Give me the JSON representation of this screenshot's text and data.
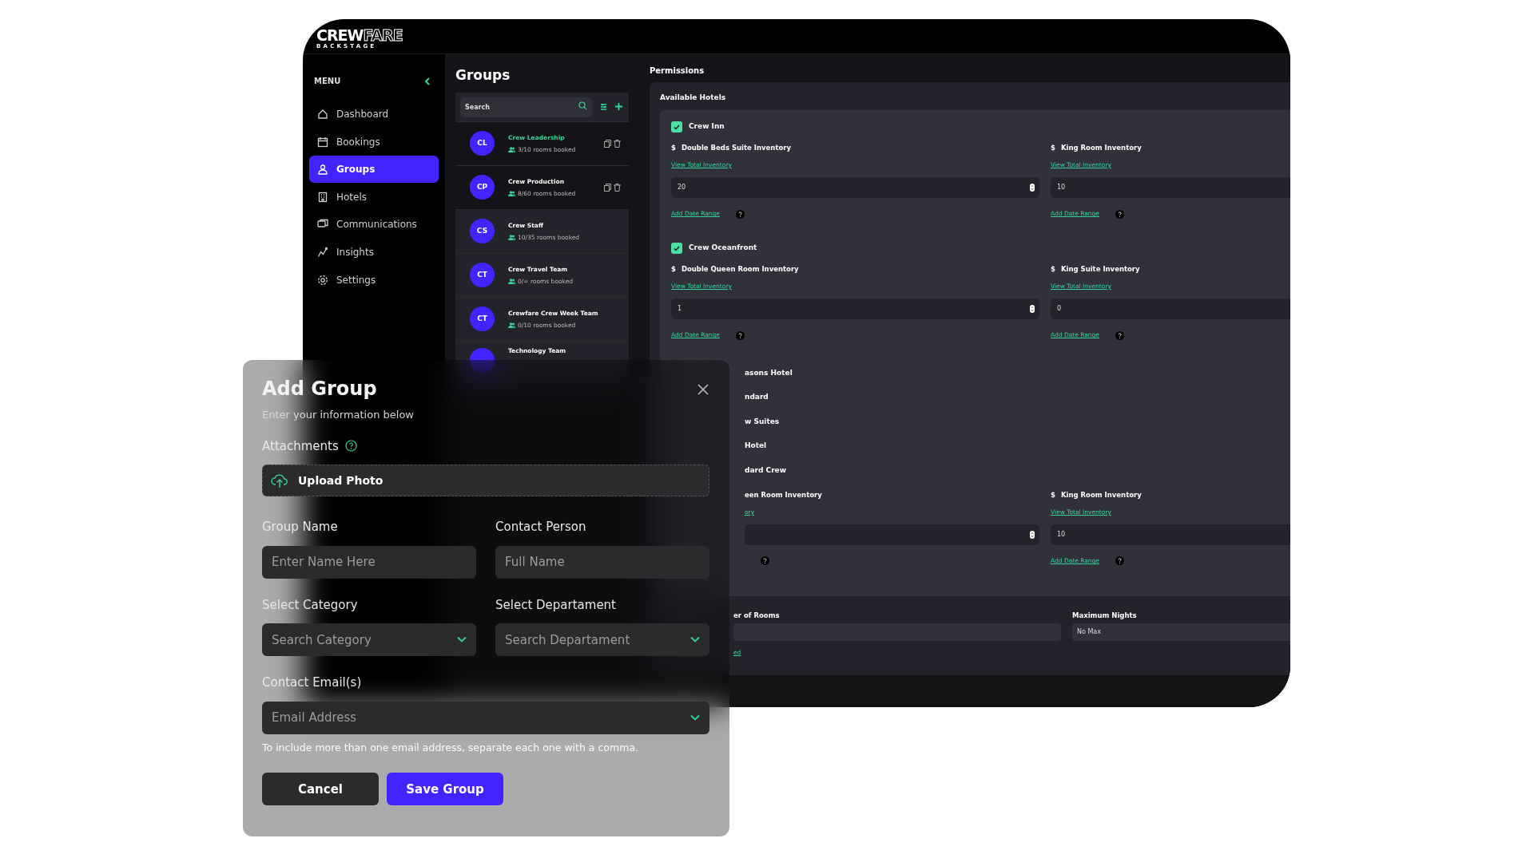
{
  "logo": {
    "main": "CREW",
    "accent": "FARE",
    "sub": "BACKSTAGE"
  },
  "sidebar": {
    "heading": "MENU",
    "items": [
      {
        "label": "Dashboard",
        "selected": false
      },
      {
        "label": "Bookings",
        "selected": false
      },
      {
        "label": "Groups",
        "selected": true
      },
      {
        "label": "Hotels",
        "selected": false
      },
      {
        "label": "Communications",
        "selected": false
      },
      {
        "label": "Insights",
        "selected": false
      },
      {
        "label": "Settings",
        "selected": false
      }
    ]
  },
  "groups": {
    "title": "Groups",
    "search_placeholder": "Search",
    "items": [
      {
        "initials": "CL",
        "name": "Crew Leadership",
        "rooms": "3/10 rooms booked",
        "selected": true,
        "actions": true
      },
      {
        "initials": "CP",
        "name": "Crew Production",
        "rooms": "8/60 rooms booked",
        "selected": false,
        "actions": true
      },
      {
        "initials": "CS",
        "name": "Crew Staff",
        "rooms": "10/35 rooms booked",
        "selected": false,
        "actions": false
      },
      {
        "initials": "CT",
        "name": "Crew Travel Team",
        "rooms": "0/∞ rooms booked",
        "selected": false,
        "actions": false
      },
      {
        "initials": "CT",
        "name": "Crewfare Crew Week Team",
        "rooms": "0/10 rooms booked",
        "selected": false,
        "actions": false
      },
      {
        "name": "Technology Team",
        "selected": false,
        "actions": false
      }
    ]
  },
  "permissions": {
    "title": "Permissions",
    "section": "Available Hotels",
    "hotels": [
      {
        "name": "Crew Inn",
        "checked": true,
        "rooms": [
          {
            "currency": "$",
            "label": "Double Beds Suite Inventory",
            "link": "View Total Inventory",
            "value": "20",
            "spinner": true,
            "date_link": "Add Date Range"
          },
          {
            "currency": "$",
            "label": "King Room Inventory",
            "link": "View Total Inventory",
            "value": "10",
            "date_link": "Add Date Range"
          }
        ]
      },
      {
        "name": "Crew Oceanfront",
        "checked": true,
        "rooms": [
          {
            "currency": "$",
            "label": "Double Queen Room Inventory",
            "link": "View Total Inventory",
            "value": "1",
            "spinner": true,
            "date_link": "Add Date Range"
          },
          {
            "currency": "$",
            "label": "King Suite Inventory",
            "link": "View Total Inventory",
            "value": "0",
            "date_link": "Add Date Range"
          }
        ]
      },
      {
        "name": "asons Hotel"
      },
      {
        "name": "ndard"
      },
      {
        "name": "w Suites"
      },
      {
        "name": "Hotel"
      },
      {
        "name": "dard Crew",
        "rooms": [
          {
            "label": "een Room Inventory",
            "link": "ory",
            "spinner": true
          },
          {
            "currency": "$",
            "label": "King Room Inventory",
            "link": "View Total Inventory",
            "value": "10",
            "date_link": "Add Date Range"
          }
        ]
      }
    ],
    "limits": [
      {
        "label": "er of Rooms",
        "link": "ed"
      },
      {
        "label": "Maximum Nights",
        "value": "No Max"
      }
    ]
  },
  "modal": {
    "title": "Add Group",
    "subtitle": "Enter your information below",
    "attachments": "Attachments",
    "upload": "Upload Photo",
    "fields": [
      {
        "label": "Group Name",
        "placeholder": "Enter Name Here",
        "kind": "text"
      },
      {
        "label": "Contact Person",
        "placeholder": "Full Name",
        "kind": "text"
      },
      {
        "label": "Select Category",
        "placeholder": "Search Category",
        "kind": "select"
      },
      {
        "label": "Select Departament",
        "placeholder": "Search Departament",
        "kind": "select"
      }
    ],
    "email": {
      "label": "Contact Email(s)",
      "placeholder": "Email Address",
      "kind": "select"
    },
    "hint": "To include more than one email address, separate each one with a comma.",
    "buttons": [
      {
        "label": "Cancel",
        "kind": "secondary"
      },
      {
        "label": "Save Group",
        "kind": "primary"
      }
    ]
  }
}
